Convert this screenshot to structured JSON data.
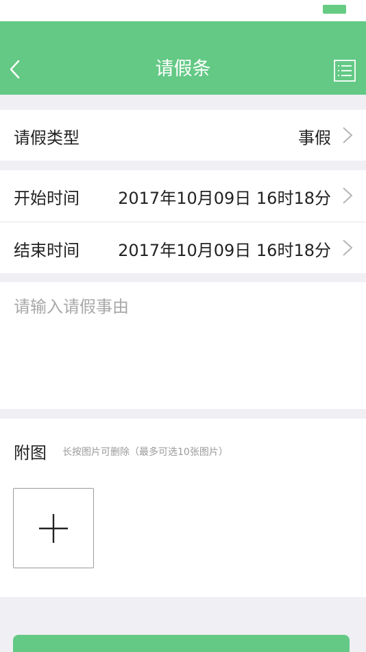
{
  "colors": {
    "accent": "#63c985",
    "background": "#efeff4"
  },
  "header": {
    "title": "请假条",
    "back_icon": "chevron-left-icon",
    "menu_icon": "list-icon"
  },
  "leave_type": {
    "label": "请假类型",
    "value": "事假"
  },
  "start_time": {
    "label": "开始时间",
    "value": "2017年10月09日 16时18分"
  },
  "end_time": {
    "label": "结束时间",
    "value": "2017年10月09日 16时18分"
  },
  "reason": {
    "placeholder": "请输入请假事由",
    "value": ""
  },
  "attachments": {
    "title": "附图",
    "hint": "长按图片可删除（最多可选10张图片）",
    "add_icon": "plus-icon"
  }
}
